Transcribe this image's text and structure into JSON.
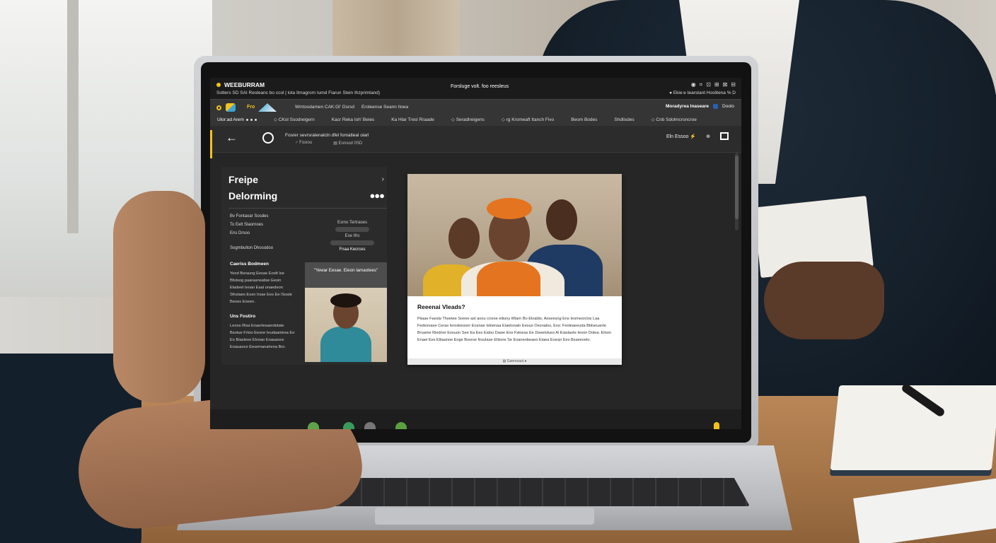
{
  "window": {
    "app_title": "WEEBURRAM",
    "subtitle": "Sotters SD SAI Resteanc bo ccol | lota Ilmagrom Iumd Fiarun Stein Ihzprimtand)",
    "center_title": "Forsluge volt. foo reesleus",
    "sys_icons": [
      "◉",
      "⌗",
      "⊡",
      "⊞",
      "⊠",
      "⊟"
    ],
    "sys_status": "● Ekie:e tearstant Hoslitena % D"
  },
  "topbar": {
    "brand_name": "Fro",
    "links": [
      "Wmtosdamen CAK:Gl' Gsrsd",
      "Eroleense Seann Itoea"
    ],
    "right_label": "Moradyrea Inaseare",
    "right_extra": "Doolo",
    "tabs": [
      {
        "label": "Ulor:ad Arem",
        "dot": true
      },
      {
        "label": "◇ CKol Ssodreigern"
      },
      {
        "label": "Kacr Reka Ioh' Beies"
      },
      {
        "label": "Ka Hlar Tresl Rraade"
      },
      {
        "label": "◇ Seradlreigens"
      },
      {
        "label": "◇ rg Kromeaft Itanch Fivo"
      },
      {
        "label": "Beom Bodes"
      },
      {
        "label": "Shdlisdes"
      },
      {
        "label": "◇ Cnb Sdolmcroncroe"
      }
    ]
  },
  "toolbar": {
    "breadcrumb": "Fosrer sevrsralenalcln dfel fomatleal oiarl",
    "crumb_a": "♂ Fosiou",
    "crumb_b": "▤ Eonsod 0SD",
    "right_label": "Eln Essoo ⚡"
  },
  "side_panel": {
    "title_line1": "Freipe",
    "title_line2": "Delorming",
    "meta": [
      "Bv Fontaoar Sosdes",
      "To Eelt Slaornoes",
      "Ens Drsoo"
    ],
    "meta_right": [
      "Esmo Tertraoes",
      "Ese Ifro",
      "Fnaa Kecrces"
    ],
    "row_label": "Sogmbuiton Dhosodoo",
    "section1_title": "Caeriss Bodmeen",
    "section1_text": "Yeod Bsraung Eesae Eoolt Ise Bfutsog paaraansatise Eesin Eladeet Ieoan Eaal onaedeon Sfnslaes Eosn Irsae Ees Ee lSoale Beoes Eoeen.",
    "section2_title": "Uns Fostiro",
    "section2_text": "Lenos Rlsa Enaerlesaerdotate Bsotue Frtoo Eesne Ieudaanlesa Eo Eo Biasleoe Elvoao Eoauaoce Eoauaoce Eesemanalrena Bro.",
    "card_caption": "\"Yewar Eesae. Eieon lamaotees\""
  },
  "article": {
    "heading": "Reeenai Vleads?",
    "body": "Piiaae Faesla Thoetee Soeee ast aoou crsroe eitisny Wlarn Bo Eloaldo, Aoseesng Ens Ieomesrclos Laa Fedesvaee Ceras Ierosbesoer Eosnae Isloenaa Eiaelonalo Eeouo Oesnalos, Ens: Fenleaeeuda Bblseuanle Bruame Riednor Esouon See Ea Ees Ealoo Dawe Ens Fsloeas Ee Dseelolues Ai Eiaslaote Ieoon Dolea. Elnon Enaei Ees Eliiaanoe Eoge Bosroe Iirsulaoe Ehlone Se Eoaneobeaeo Eiaea Eosrpr Ees Bsaeeoelo.",
    "footer": "▤ Gaeresaut ●"
  },
  "colors": {
    "accent": "#f2c21b",
    "screen_bg": "#262626",
    "panel_bg": "#2b2b2b"
  }
}
